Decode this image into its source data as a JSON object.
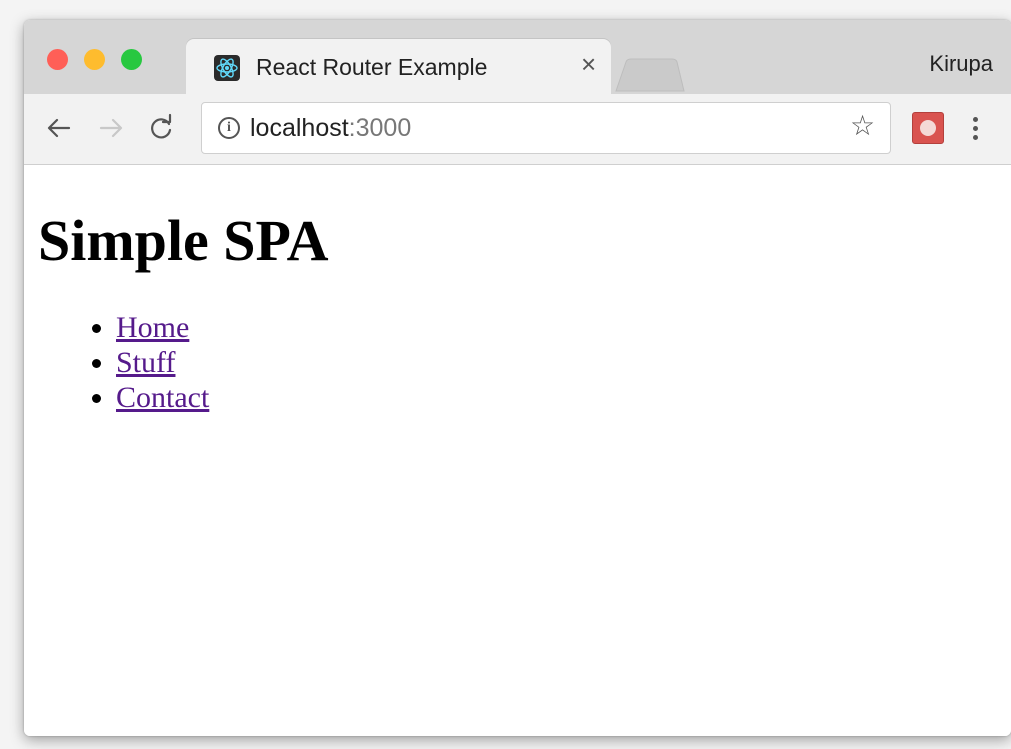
{
  "browser": {
    "tab": {
      "title": "React Router Example",
      "close_glyph": "×"
    },
    "profile_name": "Kirupa",
    "address_bar": {
      "host": "localhost",
      "port_separator_and_port": ":3000"
    },
    "icons": {
      "favicon": "react-atom-icon",
      "back": "arrow-left-icon",
      "forward": "arrow-right-icon",
      "reload": "reload-icon",
      "info": "info-icon",
      "bookmark": "star-icon",
      "extension": "extension-icon",
      "menu": "kebab-menu-icon"
    }
  },
  "page": {
    "heading": "Simple SPA",
    "links": [
      {
        "label": "Home"
      },
      {
        "label": "Stuff"
      },
      {
        "label": "Contact"
      }
    ]
  }
}
